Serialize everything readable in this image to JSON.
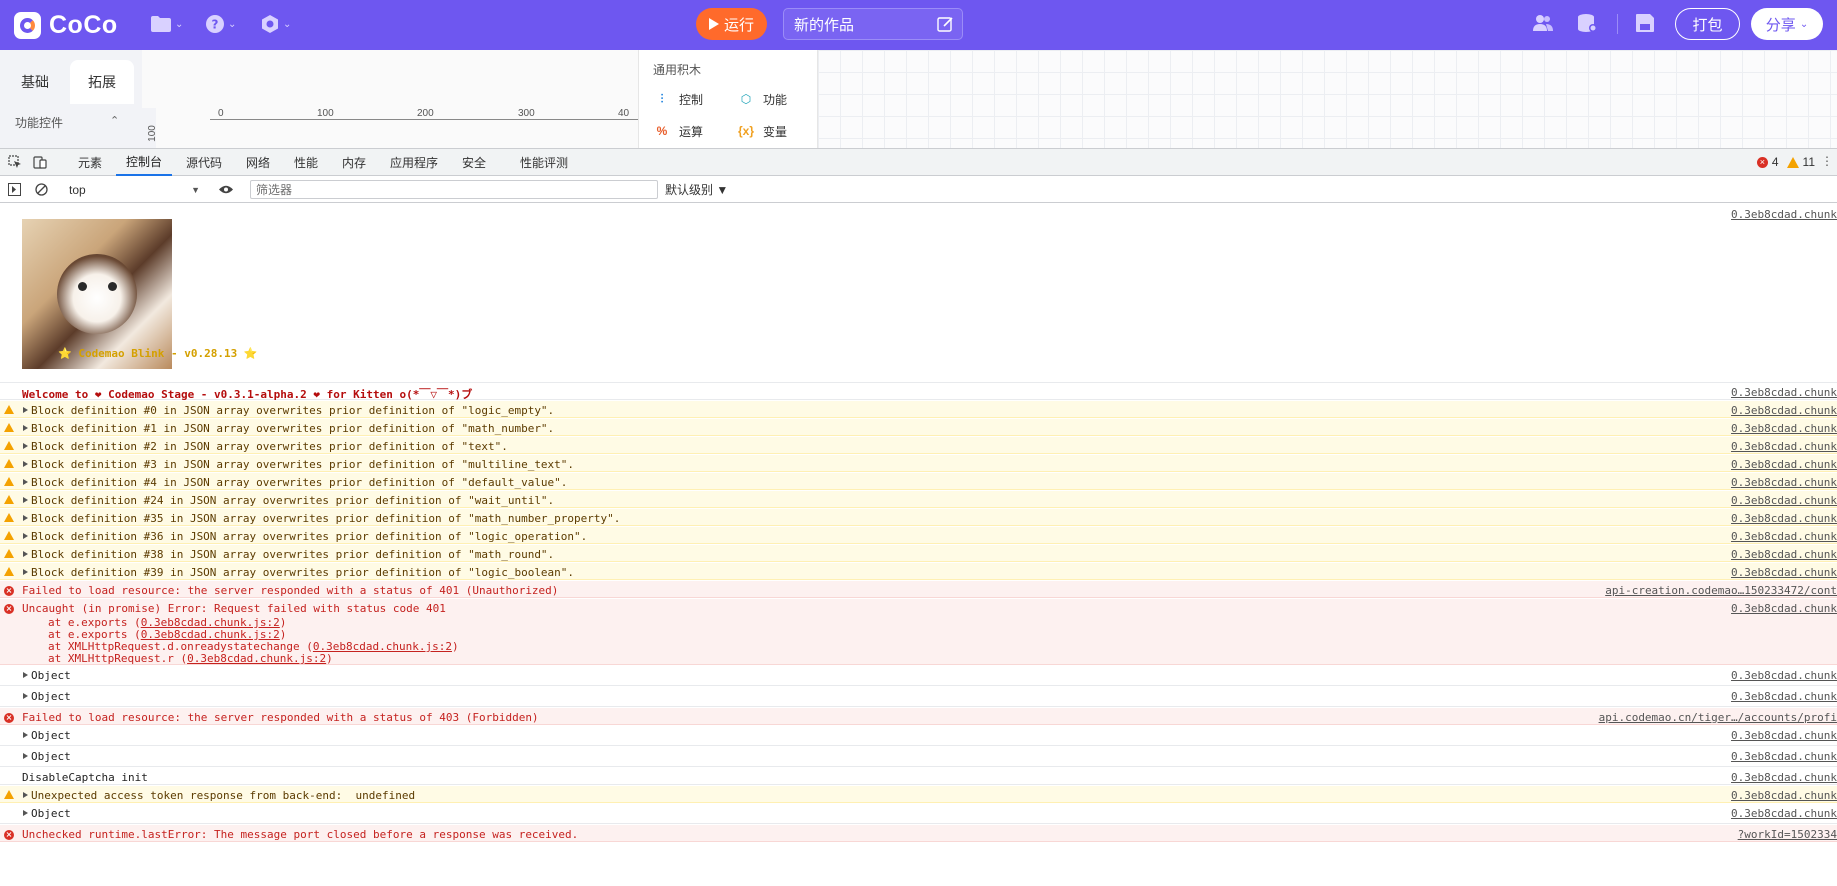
{
  "app": {
    "logo_text": "CoCo",
    "run_label": "运行",
    "work_title": "新的作品",
    "pack_label": "打包",
    "share_label": "分享"
  },
  "editor": {
    "tabs": [
      "基础",
      "拓展"
    ],
    "active_tab": "拓展",
    "subheading": "功能控件",
    "ruler_ticks": [
      "0",
      "100",
      "200",
      "300",
      "40"
    ],
    "ruler_v_tick": "100",
    "block_panel_title": "通用积木",
    "blocks": [
      "控制",
      "功能",
      "运算",
      "变量"
    ]
  },
  "devtools": {
    "tabs": [
      "元素",
      "控制台",
      "源代码",
      "网络",
      "性能",
      "内存",
      "应用程序",
      "安全",
      "性能评测"
    ],
    "active_tab": "控制台",
    "error_count": "4",
    "warning_count": "11",
    "context": "top",
    "filter_placeholder": "筛选器",
    "level": "默认级别 ▼"
  },
  "console": {
    "banner_text": "⭐ Codemao Blink - v0.28.13 ⭐",
    "banner_src": "0.3eb8cdad.chunk",
    "rows": [
      {
        "type": "log",
        "msg": "Welcome to ❤ Codemao Stage - v0.3.1-alpha.2 ❤ for Kitten o(*￣▽￣*)ブ",
        "src": "0.3eb8cdad.chunk",
        "welcome": true
      },
      {
        "type": "warn",
        "msg": "Block definition #0 in JSON array overwrites prior definition of \"logic_empty\".",
        "src": "0.3eb8cdad.chunk",
        "expand": true
      },
      {
        "type": "warn",
        "msg": "Block definition #1 in JSON array overwrites prior definition of \"math_number\".",
        "src": "0.3eb8cdad.chunk",
        "expand": true
      },
      {
        "type": "warn",
        "msg": "Block definition #2 in JSON array overwrites prior definition of \"text\".",
        "src": "0.3eb8cdad.chunk",
        "expand": true
      },
      {
        "type": "warn",
        "msg": "Block definition #3 in JSON array overwrites prior definition of \"multiline_text\".",
        "src": "0.3eb8cdad.chunk",
        "expand": true
      },
      {
        "type": "warn",
        "msg": "Block definition #4 in JSON array overwrites prior definition of \"default_value\".",
        "src": "0.3eb8cdad.chunk",
        "expand": true
      },
      {
        "type": "warn",
        "msg": "Block definition #24 in JSON array overwrites prior definition of \"wait_until\".",
        "src": "0.3eb8cdad.chunk",
        "expand": true
      },
      {
        "type": "warn",
        "msg": "Block definition #35 in JSON array overwrites prior definition of \"math_number_property\".",
        "src": "0.3eb8cdad.chunk",
        "expand": true
      },
      {
        "type": "warn",
        "msg": "Block definition #36 in JSON array overwrites prior definition of \"logic_operation\".",
        "src": "0.3eb8cdad.chunk",
        "expand": true
      },
      {
        "type": "warn",
        "msg": "Block definition #38 in JSON array overwrites prior definition of \"math_round\".",
        "src": "0.3eb8cdad.chunk",
        "expand": true
      },
      {
        "type": "warn",
        "msg": "Block definition #39 in JSON array overwrites prior definition of \"logic_boolean\".",
        "src": "0.3eb8cdad.chunk",
        "expand": true
      },
      {
        "type": "error",
        "msg": "Failed to load resource: the server responded with a status of 401 (Unauthorized)",
        "src": "api-creation.codemao…150233472/cont"
      },
      {
        "type": "error",
        "msg": "Uncaught (in promise) Error: Request failed with status code 401",
        "src": "0.3eb8cdad.chunk",
        "stack": [
          {
            "pre": "at e.exports (",
            "link": "0.3eb8cdad.chunk.js:2",
            "post": ")"
          },
          {
            "pre": "at e.exports (",
            "link": "0.3eb8cdad.chunk.js:2",
            "post": ")"
          },
          {
            "pre": "at XMLHttpRequest.d.onreadystatechange (",
            "link": "0.3eb8cdad.chunk.js:2",
            "post": ")"
          },
          {
            "pre": "at XMLHttpRequest.r (",
            "link": "0.3eb8cdad.chunk.js:2",
            "post": ")"
          }
        ]
      },
      {
        "type": "log",
        "msg": "Object",
        "src": "0.3eb8cdad.chunk",
        "expand": true
      },
      {
        "type": "log",
        "msg": "Object",
        "src": "0.3eb8cdad.chunk",
        "expand": true
      },
      {
        "type": "error",
        "msg": "Failed to load resource: the server responded with a status of 403 (Forbidden)",
        "src": "api.codemao.cn/tiger…/accounts/profi"
      },
      {
        "type": "log",
        "msg": "Object",
        "src": "0.3eb8cdad.chunk",
        "expand": true
      },
      {
        "type": "log",
        "msg": "Object",
        "src": "0.3eb8cdad.chunk",
        "expand": true
      },
      {
        "type": "log",
        "msg": "DisableCaptcha init",
        "src": "0.3eb8cdad.chunk"
      },
      {
        "type": "warn",
        "msg": "Unexpected access token response from back-end:  undefined",
        "src": "0.3eb8cdad.chunk",
        "expand": true
      },
      {
        "type": "log",
        "msg": "Object",
        "src": "0.3eb8cdad.chunk",
        "expand": true
      },
      {
        "type": "error",
        "msg": "Unchecked runtime.lastError: The message port closed before a response was received.",
        "src": "?workId=1502334"
      }
    ]
  },
  "colors": {
    "brand": "#6e57f0",
    "run": "#ff6a2b",
    "error": "#d93025",
    "warning": "#f4a200"
  }
}
